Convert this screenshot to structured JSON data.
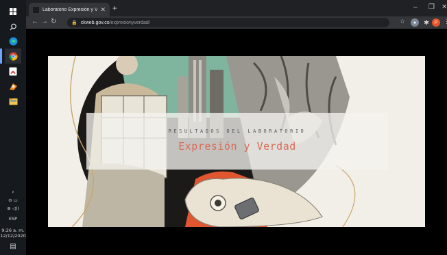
{
  "browser": {
    "tab_title": "Laboratorio Expresión y Verdad",
    "url_host": "ckweb.gov.co",
    "url_path": "/expresionyverdad/",
    "profile_letter": "P"
  },
  "banner": {
    "eyebrow": "RESULTADOS DEL LABORATORIO",
    "title": "Expresión y Verdad"
  },
  "taskbar": {
    "language": "ESP",
    "time": "9:26 a. m.",
    "date": "12/12/2020"
  },
  "icons": {
    "windows": "windows-start-icon",
    "search": "search-icon",
    "edge": "edge-icon",
    "chrome": "chrome-icon",
    "acrobat": "acrobat-icon",
    "app": "orange-app-icon",
    "explorer": "file-explorer-icon"
  }
}
